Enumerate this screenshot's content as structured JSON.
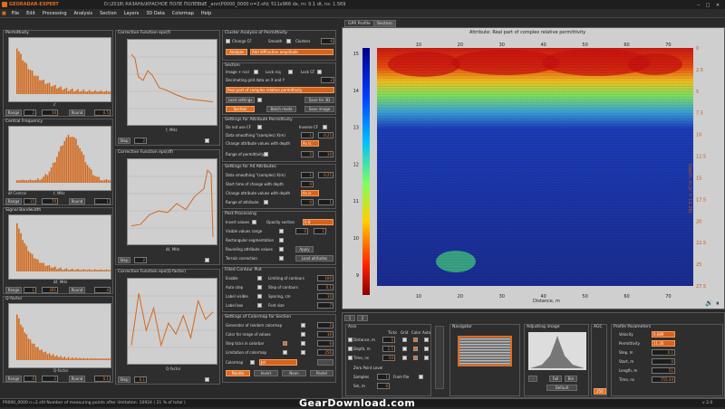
{
  "app": {
    "title": "GEORADAR-EXPERT",
    "file": "D:\\2018\\ КАЗАНЬ\\КРАСНОЕ ПОЛЕ ПОЛЕВЫЕ _ann\\P0000_0000 n=2.sfd;   511x966   dx, m: 0.1   dt, ns: 1.569"
  },
  "menu": [
    "File",
    "Edit",
    "Processing",
    "Analysis",
    "Section",
    "Layers",
    "3D Data",
    "Colormap",
    "Help"
  ],
  "left": [
    {
      "title": "Permittivity",
      "xlabel": "ε'",
      "range": "Range",
      "v1": "2",
      "v2": "10",
      "round": "Round",
      "v3": "0.5"
    },
    {
      "title": "Central Frequency",
      "xlabel": "f, MHz",
      "subtitle": "Δf Central",
      "range": "Range",
      "v1": "15",
      "v2": "70",
      "round": "Round",
      "v3": "1"
    },
    {
      "title": "Signal Bandwidth",
      "xlabel": "Δf, MHz",
      "range": "Range",
      "v1": "1",
      "v2": "301",
      "round": "Round",
      "v3": "4"
    },
    {
      "title": "Q-factor",
      "xlabel": "Q-factor",
      "range": "Range",
      "v1": "0",
      "v2": "2",
      "round": "Round",
      "v3": "0.1"
    }
  ],
  "mid": [
    {
      "title": "Corrective Function eps(f)",
      "xlabel": "f, MHz",
      "step": "Step",
      "val": "2"
    },
    {
      "title": "Corrective Function eps(df)",
      "xlabel": "Δf, MHz",
      "step": "Step",
      "val": "2"
    },
    {
      "title": "Corrective Function eps(Q-factor)",
      "xlabel": "Q-factor",
      "step": "Step",
      "val": "0.1"
    }
  ],
  "cluster": {
    "title": "Cluster Analysis of Permittivity",
    "change": "Change CF",
    "smooth": "Smooth",
    "clusters": "Clusters",
    "clusters_val": "6",
    "analyse": "Analyse",
    "method": "Add diffraction amplitude"
  },
  "section": {
    "title": "Section",
    "image": "Image + rcol",
    "lock_rcol": "Lock rcq",
    "lock_cf": "Lock CF",
    "decim": "Decimating grid data on X and Y",
    "decim_val": "2",
    "attr": "Real part of complex relative permittivity",
    "load": "Load settings",
    "save": "Save for 3D",
    "section_btn": "Section",
    "batch": "Batch mode",
    "save_image": "Save image"
  },
  "perm_settings": {
    "title": "Settings for Attribute Permittivity",
    "do_not_use": "Do not use CF",
    "inverse": "Inverse CF",
    "smoothing": "Data smoothing  \"(samples)  X(m)",
    "s1": "1",
    "s2": "0.25",
    "change": "Change attribute values with depth",
    "change_val": "As is",
    "range": "Range of permittivity",
    "r1": "2",
    "r2": "10"
  },
  "all_settings": {
    "title": "Settings for All Attributes",
    "smoothing": "Data smoothing  \"(samples)  X(m)",
    "s1": "1",
    "s2": "0.25",
    "start": "Start time of change with depth",
    "start_val": "0",
    "change": "Change attribute values with depth",
    "change_val": "As is",
    "range": "Range of attribute",
    "r1": "0",
    "r2": "1"
  },
  "post": {
    "title": "Post Processing",
    "invert": "Invert values",
    "opacity": "Opacity section",
    "opacity_val": "0.8",
    "visible": "Visible values range",
    "rect": "Rectangular segmentation",
    "round": "Rounding attribute values",
    "terrain": "Terrain correction",
    "apply": "Apply",
    "load_alt": "Load altitudes"
  },
  "contour": {
    "title": "Filled Contour Plot",
    "enable": "Enable",
    "limiting": "Limiting of contours",
    "limiting_val": "100",
    "auto": "Auto step",
    "step": "Step of contours",
    "step_val": "0.1",
    "label": "Label visible",
    "spacing": "Spacing, cm",
    "spacing_val": "10",
    "labelbox": "Label box",
    "fontsize": "Font size",
    "fontsize_val": "7"
  },
  "colormap": {
    "title": "Settings of Colormap for Section",
    "gen": "Generator of random colormap",
    "gen_val": "2",
    "color_range": "Color for range of values",
    "color_range_val": "16",
    "ticks": "Step ticks in colorbar",
    "ticks_val": "6",
    "limit": "Limitation of colormap",
    "limit_val": "256",
    "cmap": "Colormap",
    "cmap_val": "Jet",
    "palette": "Palette",
    "invert": "Invert",
    "neon": "Neon",
    "pastel": "Pastel"
  },
  "radar": {
    "tab_gpr": "GPR Profile",
    "tab_section": "Section",
    "attr_title": "Attribute:  Real part of complex relative permittivity",
    "xlabel": "Distance, m",
    "ylabel_right": "Depth, m (ε' = 11.26)",
    "xticks": [
      "10",
      "20",
      "30",
      "40",
      "50",
      "60",
      "70"
    ],
    "yleft": [
      "15",
      "14",
      "13",
      "12",
      "11",
      "10",
      "9"
    ],
    "yright": [
      "0",
      "2.5",
      "5",
      "7.5",
      "10",
      "12.5",
      "15",
      "17.5",
      "20",
      "22.5",
      "25",
      "27.5"
    ]
  },
  "bottom": {
    "tabs": [
      "1",
      "2"
    ],
    "axis": "Axis",
    "ticks": "Ticks",
    "grid": "Grid",
    "color": "Color",
    "auto": "Auto",
    "distance": "Distance, m",
    "distance_val": "5",
    "depth": "Depth, m",
    "depth_val": "2.5",
    "time": "Time, ns",
    "time_val": "50",
    "zero": "Zero Point Level",
    "samples": "Samples",
    "samples_val": "1",
    "from_file": "From file",
    "sm": "Sm, m",
    "sm_val": "0",
    "navigator": "Navigator",
    "adjusting": "Adjusting image",
    "full": "Full",
    "bin": "Bin",
    "default": "Default",
    "agc": "AGC",
    "agc_val": "256",
    "params_title": "Profile Parameters",
    "velocity": "Velocity",
    "velocity_val": "0.089",
    "permittivity": "Permittivity",
    "permittivity_val": "11.26",
    "step": "Step, m",
    "step_val": "0.1",
    "start": "Start, m",
    "start_val": "0",
    "length": "Length, m",
    "length_val": "51",
    "time_ns": "Time, ns",
    "time_ns_val": "755.44"
  },
  "status": {
    "text": "P0000_0000 n=2.sfd        Number of measuring points after limitation: 10924  ( 21 % of total )",
    "version": "v 2.0"
  },
  "watermark": "GearDownload.com",
  "colors": {
    "accent": "#e06c1e",
    "background": "#2a2a2a"
  }
}
